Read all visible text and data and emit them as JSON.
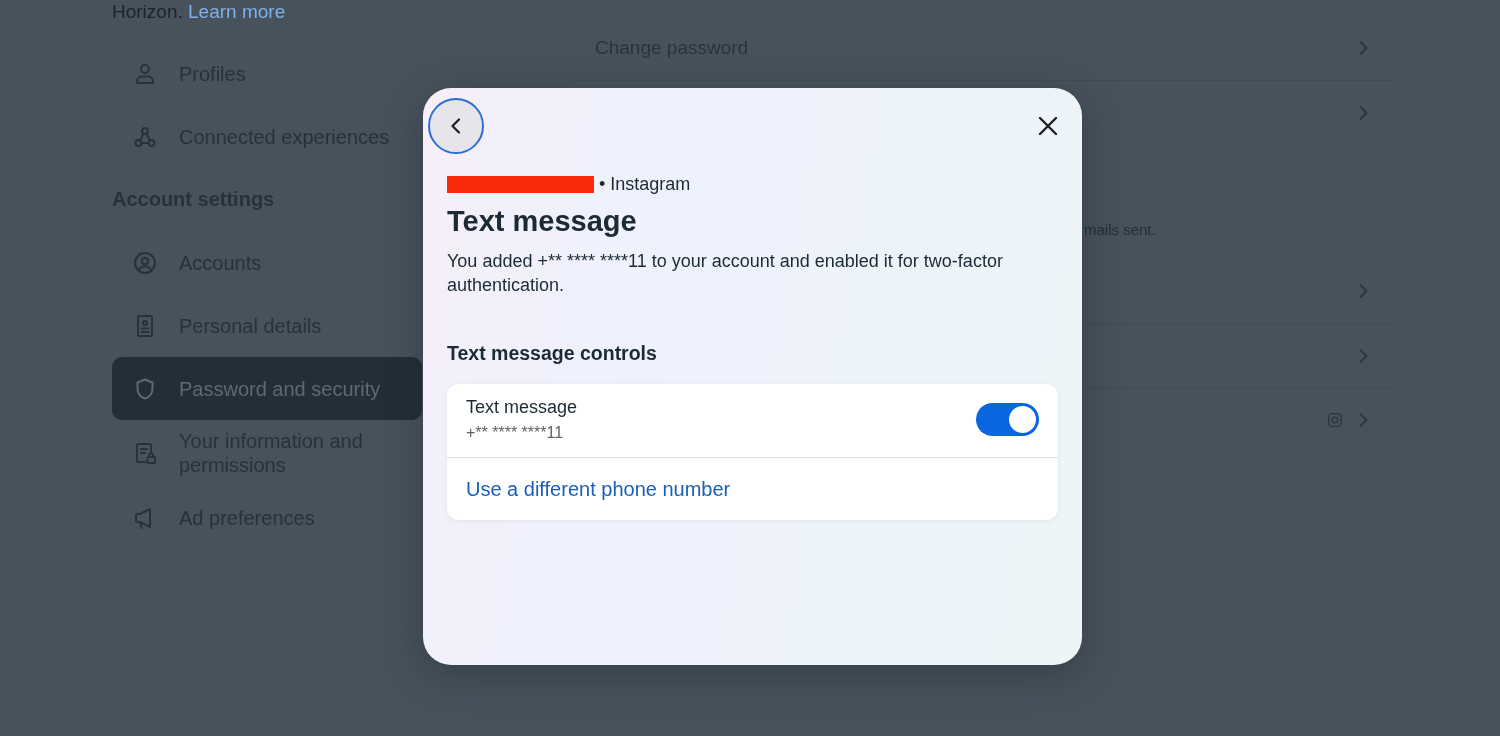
{
  "sidebar": {
    "intro": {
      "text": "Horizon.",
      "link": "Learn more"
    },
    "sections": [
      {
        "items": [
          {
            "label": "Profiles",
            "selected": false
          },
          {
            "label": "Connected experiences",
            "selected": false
          }
        ]
      },
      {
        "heading": "Account settings",
        "items": [
          {
            "label": "Accounts",
            "selected": false
          },
          {
            "label": "Personal details",
            "selected": false
          },
          {
            "label": "Password and security",
            "selected": true
          },
          {
            "label": "Your information and permissions",
            "selected": false
          },
          {
            "label": "Ad preferences",
            "selected": false
          }
        ]
      }
    ]
  },
  "settings": {
    "cards": [
      {
        "rows": [
          {
            "kind": "link",
            "label": "Change password"
          },
          {
            "kind": "link"
          }
        ]
      },
      {
        "note": "mails sent.",
        "rows": [
          {
            "kind": "link"
          },
          {
            "kind": "link"
          },
          {
            "kind": "app_link"
          }
        ]
      }
    ]
  },
  "dialog": {
    "back_button": {
      "focused": true
    },
    "account": {
      "redacted": true,
      "suffix": "• Instagram"
    },
    "title": "Text message",
    "description": "You added +** **** ****11 to your account and enabled it for two-factor authentication.",
    "section_title": "Text message controls",
    "control": {
      "label": "Text message",
      "value": "+** **** ****11",
      "on": true
    },
    "link": "Use a different phone number"
  }
}
